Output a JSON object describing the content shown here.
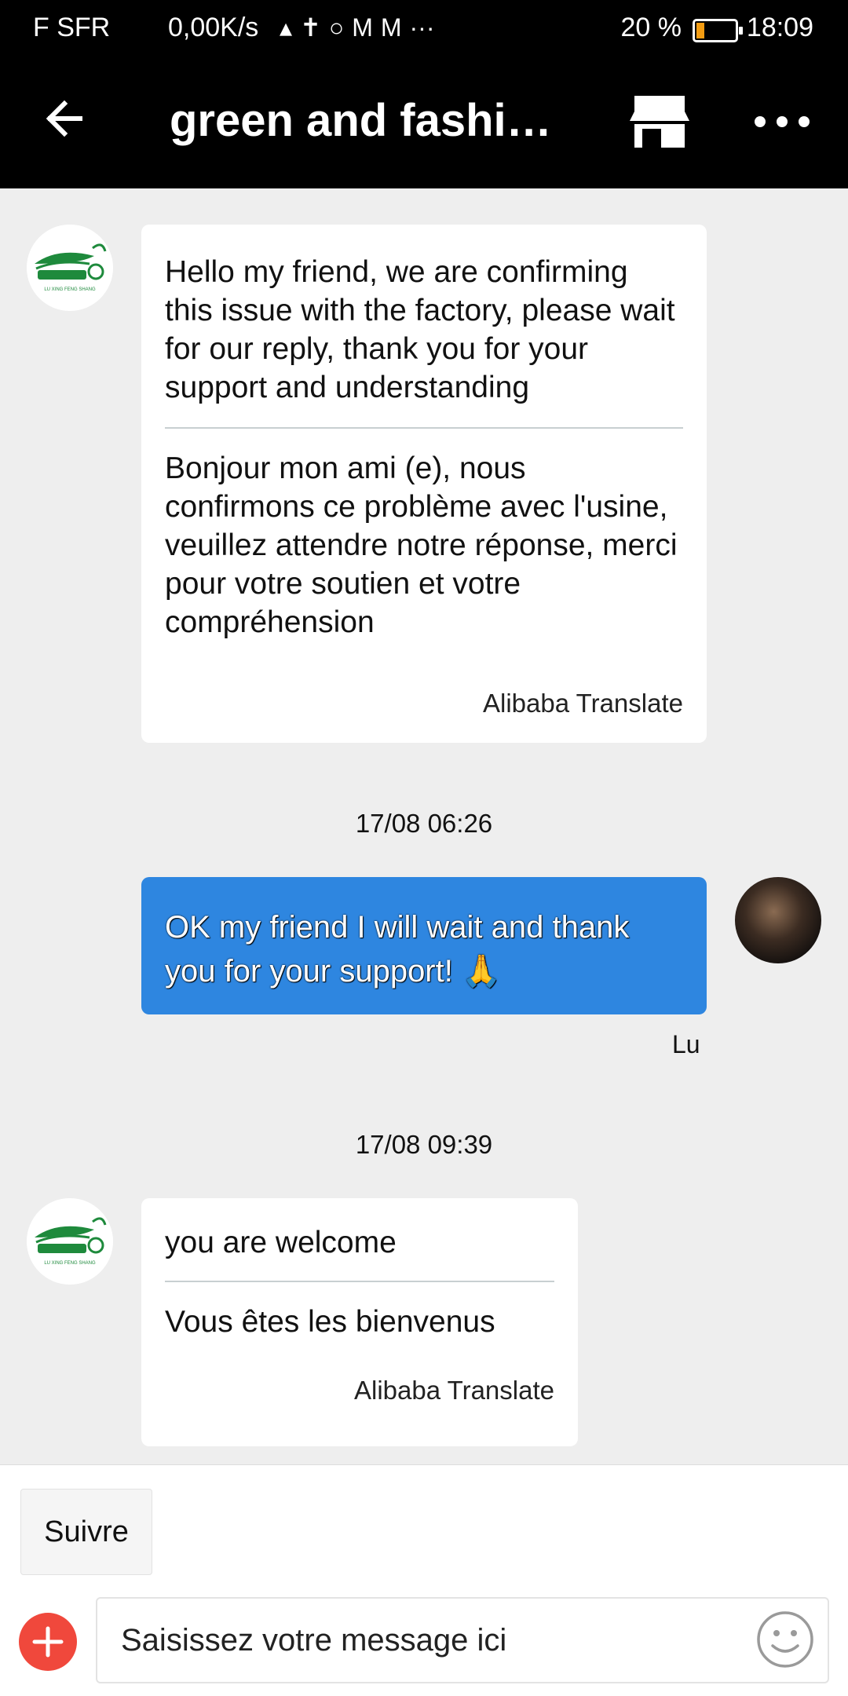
{
  "status_bar": {
    "carrier": "F SFR",
    "network_speed": "0,00K/s",
    "battery_percent": "20 %",
    "time": "18:09",
    "battery_level": 0.2,
    "colors": {
      "battery_fill": "#f39c12"
    }
  },
  "header": {
    "title": "green and fashio…"
  },
  "messages": [
    {
      "original": "Hello my friend, we are confirming this issue with the factory, please wait for our reply, thank you for your support and understanding",
      "translation": "Bonjour mon ami (e), nous confirmons ce problème avec l'usine, veuillez attendre notre réponse, merci pour votre soutien et votre compréhension",
      "credit": "Alibaba Translate"
    },
    {
      "timestamp": "17/08 06:26",
      "text": "OK my friend I will wait and thank you for your support! 🙏",
      "sender": "Lu"
    },
    {
      "timestamp": "17/08 09:39",
      "original": "you are welcome",
      "translation": "Vous êtes les bienvenus",
      "credit": "Alibaba Translate"
    }
  ],
  "shop_logo_text": "LU XING FENG SHANG",
  "bottom": {
    "follow_label": "Suivre",
    "input_placeholder": "Saisissez votre message ici"
  },
  "colors": {
    "sent_bubble": "#2e86e0",
    "plus_button": "#f0483c",
    "logo_green": "#1e8a3c"
  },
  "icons": [
    "back-arrow-icon",
    "store-icon",
    "more-icon",
    "plus-icon",
    "emoji-icon"
  ]
}
